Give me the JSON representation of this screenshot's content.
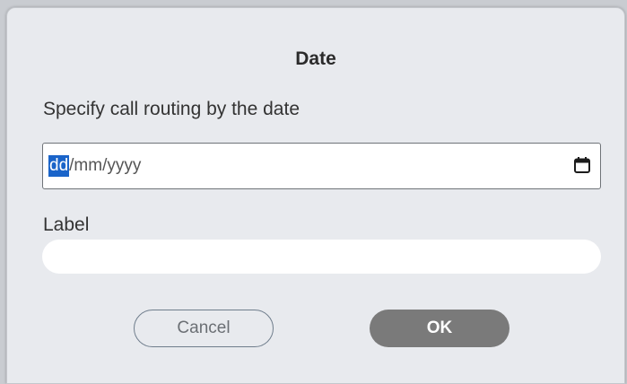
{
  "dialog": {
    "title": "Date",
    "subtitle": "Specify call routing by the date",
    "date_field": {
      "day_placeholder": "dd",
      "rest_placeholder": "/mm/yyyy",
      "icon": "calendar-icon"
    },
    "label_caption": "Label",
    "label_input": {
      "value": "",
      "placeholder": ""
    },
    "buttons": {
      "cancel": "Cancel",
      "ok": "OK"
    }
  }
}
